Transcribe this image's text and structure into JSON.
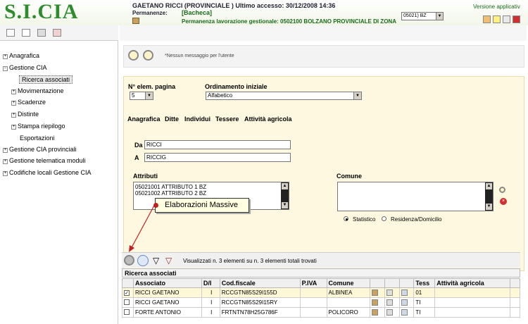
{
  "header": {
    "logo": "S.I.CIA",
    "user_line": "GAETANO RICCI (PROVINCIALE ) Ultimo accesso: 30/12/2008 14:36",
    "perm_label": "Permanenze:",
    "bacheca": "[Bacheca]",
    "perm_lav": "Permanenza lavorazione gestionale: 0502100 BOLZANO PROVINCIALE DI ZONA",
    "office_select": "05021) BZ",
    "versione": "Versione applicativ"
  },
  "tree": {
    "items": [
      {
        "label": "Anagrafica",
        "exp": "+"
      },
      {
        "label": "Gestione CIA",
        "exp": "−"
      },
      {
        "label": "Ricerca associati"
      },
      {
        "label": "Movimentazione",
        "exp": "+"
      },
      {
        "label": "Scadenze",
        "exp": "+"
      },
      {
        "label": "Distinte",
        "exp": "+"
      },
      {
        "label": "Stampa riepilogo",
        "exp": "+"
      },
      {
        "label": "Esportazioni"
      },
      {
        "label": "Gestione CIA provinciali",
        "exp": "+"
      },
      {
        "label": "Gestione telematica moduli",
        "exp": "+"
      },
      {
        "label": "Codifiche locali Gestione CIA",
        "exp": "+"
      }
    ]
  },
  "messages": {
    "text": "*Nessun messaggio per l'utente"
  },
  "form": {
    "page_size_label": "N° elem. pagina",
    "page_size_value": "5",
    "order_label": "Ordinamento iniziale",
    "order_value": "Alfabetico",
    "tabs": [
      "Anagrafica",
      "Ditte",
      "Individui",
      "Tessere",
      "Attività agricola"
    ],
    "da_label": "Da",
    "da_value": "RICCI",
    "a_label": "A",
    "a_value": "RICCIG",
    "attributi_label": "Attributi",
    "attributi_items": [
      "05021001 ATTRIBUTO 1 BZ",
      "05021002 ATTRIBUTO 2 BZ"
    ],
    "comune_label": "Comune",
    "radio_statistico": "Statistico",
    "radio_residenza": "Residenza/Domicilio"
  },
  "tooltip": "Elaborazioni Massive",
  "results": {
    "count_text": "Visualizzati n. 3 elementi su n. 3 elementi totali trovati",
    "title": "Ricerca associati",
    "columns": [
      "Associato",
      "D/I",
      "Cod.fiscale",
      "P.IVA",
      "Comune",
      "Tess",
      "Attività agricola"
    ],
    "rows": [
      {
        "checked": "✓",
        "associato": "RICCI GAETANO",
        "di": "I",
        "cf": "RCCGTN85S29I155D",
        "piva": "",
        "comune": "ALBINEA",
        "tess": "01",
        "attivita": ""
      },
      {
        "checked": "",
        "associato": "RICCI GAETANO",
        "di": "I",
        "cf": "RCCGTN85S29I15RY",
        "piva": "",
        "comune": "",
        "tess": "TI",
        "attivita": ""
      },
      {
        "checked": "",
        "associato": "FORTE ANTONIO",
        "di": "I",
        "cf": "FRTNTN78H25G786F",
        "piva": "",
        "comune": "POLICORO",
        "tess": "TI",
        "attivita": ""
      }
    ]
  },
  "colors": {
    "brand_green": "#2e8b2e",
    "form_bg": "#fff8e0",
    "highlight_row": "#fff8d6",
    "tooltip_bg": "#ffffe1"
  }
}
